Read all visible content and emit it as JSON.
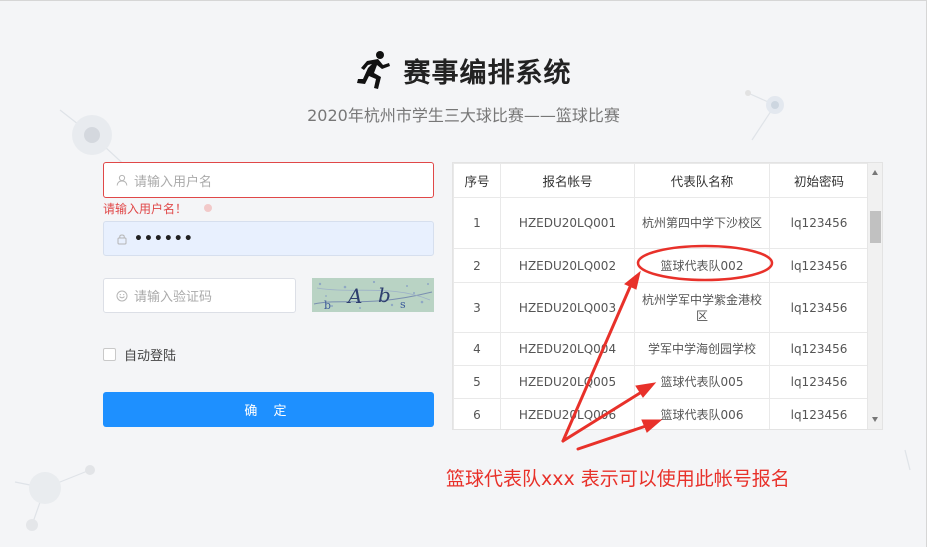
{
  "header": {
    "title": "赛事编排系统",
    "subtitle": "2020年杭州市学生三大球比赛——篮球比赛",
    "logo_icon": "runner-icon"
  },
  "form": {
    "username": {
      "placeholder": "请输入用户名",
      "value": "",
      "icon": "user-icon",
      "error": "请输入用户名！"
    },
    "password": {
      "value": "••••••",
      "icon": "lock-icon"
    },
    "captcha": {
      "placeholder": "请输入验证码",
      "icon": "shield-icon",
      "image_text": "Ab"
    },
    "remember_label": "自动登陆",
    "remember_checked": false,
    "submit_label": "确 定"
  },
  "table": {
    "headers": [
      "序号",
      "报名帐号",
      "代表队名称",
      "初始密码"
    ],
    "rows": [
      {
        "no": "1",
        "account": "HZEDU20LQ001",
        "team": "杭州第四中学下沙校区",
        "password": "lq123456"
      },
      {
        "no": "2",
        "account": "HZEDU20LQ002",
        "team": "篮球代表队002",
        "password": "lq123456"
      },
      {
        "no": "3",
        "account": "HZEDU20LQ003",
        "team": "杭州学军中学紫金港校区",
        "password": "lq123456"
      },
      {
        "no": "4",
        "account": "HZEDU20LQ004",
        "team": "学军中学海创园学校",
        "password": "lq123456"
      },
      {
        "no": "5",
        "account": "HZEDU20LQ005",
        "team": "篮球代表队005",
        "password": "lq123456"
      },
      {
        "no": "6",
        "account": "HZEDU20LQ006",
        "team": "篮球代表队006",
        "password": "lq123456"
      }
    ]
  },
  "annotation": {
    "caption": "篮球代表队xxx  表示可以使用此帐号报名",
    "color": "#e8312a"
  },
  "colors": {
    "primary": "#1e90ff",
    "error": "#e04848",
    "autofill": "#e8f0fe"
  }
}
